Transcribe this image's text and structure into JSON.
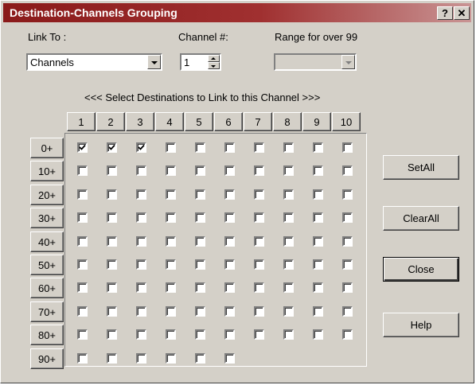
{
  "window": {
    "title": "Destination-Channels Grouping",
    "help_button": "?",
    "close_button": "✕"
  },
  "link_to": {
    "label": "Link To :",
    "value": "Channels"
  },
  "channel": {
    "label": "Channel #:",
    "value": "1"
  },
  "range": {
    "label": "Range for over 99",
    "value": ""
  },
  "instruction": "<<< Select Destinations to Link to this Channel >>>",
  "columns": [
    "1",
    "2",
    "3",
    "4",
    "5",
    "6",
    "7",
    "8",
    "9",
    "10"
  ],
  "rows": [
    {
      "label": "0+",
      "count": 10,
      "checked": [
        true,
        true,
        true,
        false,
        false,
        false,
        false,
        false,
        false,
        false
      ]
    },
    {
      "label": "10+",
      "count": 10,
      "checked": []
    },
    {
      "label": "20+",
      "count": 10,
      "checked": []
    },
    {
      "label": "30+",
      "count": 10,
      "checked": []
    },
    {
      "label": "40+",
      "count": 10,
      "checked": []
    },
    {
      "label": "50+",
      "count": 10,
      "checked": []
    },
    {
      "label": "60+",
      "count": 10,
      "checked": []
    },
    {
      "label": "70+",
      "count": 10,
      "checked": []
    },
    {
      "label": "80+",
      "count": 10,
      "checked": []
    },
    {
      "label": "90+",
      "count": 6,
      "checked": []
    }
  ],
  "actions": {
    "set_all": "SetAll",
    "clear_all": "ClearAll",
    "close": "Close",
    "help": "Help"
  },
  "colors": {
    "title_bar": "#8a1a1a",
    "face": "#d4d0c8"
  }
}
